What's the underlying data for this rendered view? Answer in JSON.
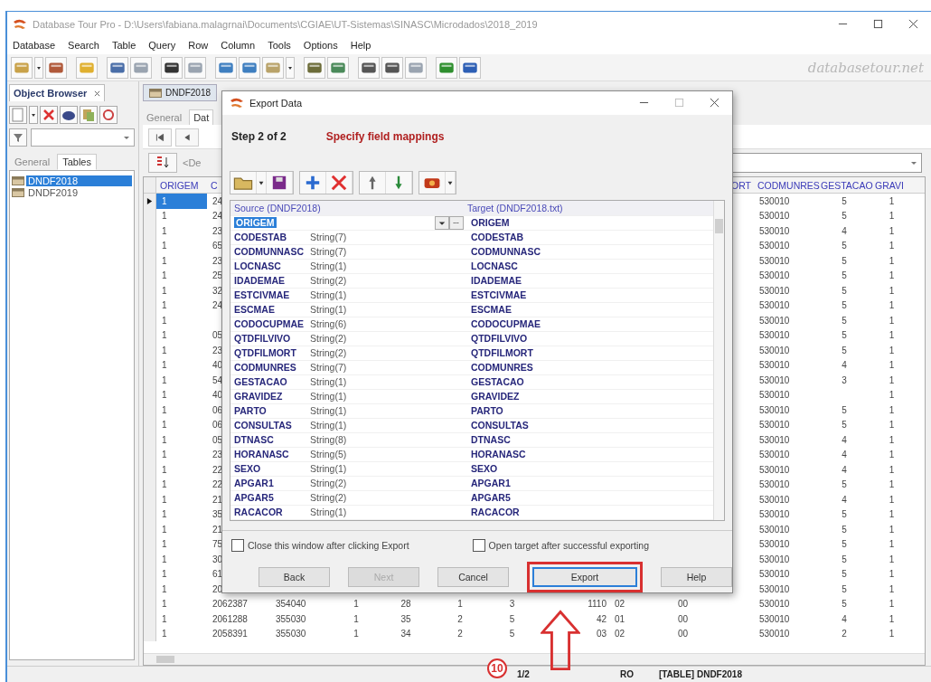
{
  "window": {
    "title": "Database Tour Pro - D:\\Users\\fabiana.malagrnai\\Documents\\CGIAE\\UT-Sistemas\\SINASC\\Microdados\\2018_2019"
  },
  "menu": [
    "Database",
    "Search",
    "Table",
    "Query",
    "Row",
    "Column",
    "Tools",
    "Options",
    "Help"
  ],
  "logo": "databasetour.net",
  "object_browser": {
    "title": "Object Browser",
    "tabs": [
      {
        "label": "General",
        "selected": false
      },
      {
        "label": "Tables",
        "selected": true
      }
    ],
    "tables": [
      {
        "name": "DNDF2018",
        "selected": true
      },
      {
        "name": "DNDF2019",
        "selected": false
      }
    ]
  },
  "document": {
    "tab": "DNDF2018",
    "subtabs": [
      {
        "label": "General",
        "selected": false
      },
      {
        "label": "Dat",
        "selected": true
      }
    ],
    "filter_label": "<De"
  },
  "grid": {
    "header_left": [
      "ORIGEM",
      "C"
    ],
    "header_right": [
      "ORT",
      "CODMUNRES",
      "GESTACAO",
      "GRAVI"
    ],
    "partial_rows": [
      {
        "selected": true,
        "origem": "1",
        "codestab": "24",
        "codmunres": "530010",
        "gestacao": "5",
        "gravidez": "1"
      },
      {
        "selected": false,
        "origem": "1",
        "codestab": "24",
        "codmunres": "530010",
        "gestacao": "5",
        "gravidez": "1"
      },
      {
        "selected": false,
        "origem": "1",
        "codestab": "23",
        "codmunres": "530010",
        "gestacao": "4",
        "gravidez": "1"
      },
      {
        "selected": false,
        "origem": "1",
        "codestab": "65",
        "codmunres": "530010",
        "gestacao": "5",
        "gravidez": "1"
      },
      {
        "selected": false,
        "origem": "1",
        "codestab": "23",
        "codmunres": "530010",
        "gestacao": "5",
        "gravidez": "1"
      },
      {
        "selected": false,
        "origem": "1",
        "codestab": "25",
        "codmunres": "530010",
        "gestacao": "5",
        "gravidez": "1"
      },
      {
        "selected": false,
        "origem": "1",
        "codestab": "32",
        "codmunres": "530010",
        "gestacao": "5",
        "gravidez": "1"
      },
      {
        "selected": false,
        "origem": "1",
        "codestab": "24",
        "codmunres": "530010",
        "gestacao": "5",
        "gravidez": "1"
      },
      {
        "selected": false,
        "origem": "1",
        "codmunres": "530010",
        "gestacao": "5",
        "gravidez": "1"
      },
      {
        "selected": false,
        "origem": "1",
        "codestab": "05",
        "codmunres": "530010",
        "gestacao": "5",
        "gravidez": "1"
      },
      {
        "selected": false,
        "origem": "1",
        "codestab": "23",
        "codmunres": "530010",
        "gestacao": "5",
        "gravidez": "1"
      },
      {
        "selected": false,
        "origem": "1",
        "codestab": "40",
        "codmunres": "530010",
        "gestacao": "4",
        "gravidez": "1"
      },
      {
        "selected": false,
        "origem": "1",
        "codestab": "54",
        "codmunres": "530010",
        "gestacao": "3",
        "gravidez": "1"
      },
      {
        "selected": false,
        "origem": "1",
        "codestab": "40",
        "codmunres": "530010",
        "gravidez": "1"
      },
      {
        "selected": false,
        "origem": "1",
        "codestab": "06",
        "codmunres": "530010",
        "gestacao": "5",
        "gravidez": "1"
      },
      {
        "selected": false,
        "origem": "1",
        "codestab": "06",
        "codmunres": "530010",
        "gestacao": "5",
        "gravidez": "1"
      },
      {
        "selected": false,
        "origem": "1",
        "codestab": "05",
        "codmunres": "530010",
        "gestacao": "4",
        "gravidez": "1"
      },
      {
        "selected": false,
        "origem": "1",
        "codestab": "23",
        "codmunres": "530010",
        "gestacao": "4",
        "gravidez": "1"
      },
      {
        "selected": false,
        "origem": "1",
        "codestab": "22",
        "codmunres": "530010",
        "gestacao": "4",
        "gravidez": "1"
      },
      {
        "selected": false,
        "origem": "1",
        "codestab": "22",
        "codmunres": "530010",
        "gestacao": "5",
        "gravidez": "1"
      },
      {
        "selected": false,
        "origem": "1",
        "codestab": "21",
        "codmunres": "530010",
        "gestacao": "4",
        "gravidez": "1"
      },
      {
        "selected": false,
        "origem": "1",
        "codestab": "35",
        "codmunres": "530010",
        "gestacao": "5",
        "gravidez": "1"
      },
      {
        "selected": false,
        "origem": "1",
        "codestab": "21",
        "codmunres": "530010",
        "gestacao": "5",
        "gravidez": "1"
      },
      {
        "selected": false,
        "origem": "1",
        "codestab": "75",
        "codmunres": "530010",
        "gestacao": "5",
        "gravidez": "1"
      },
      {
        "selected": false,
        "origem": "1",
        "codestab": "30",
        "codmunres": "530010",
        "gestacao": "5",
        "gravidez": "1"
      },
      {
        "selected": false,
        "origem": "1",
        "codestab": "61",
        "codmunres": "530010",
        "gestacao": "5",
        "gravidez": "1"
      },
      {
        "selected": false,
        "origem": "1",
        "codestab": "20",
        "codmunres": "530010",
        "gestacao": "5",
        "gravidez": "1"
      }
    ],
    "rows": [
      {
        "selected": false,
        "cells": [
          "1",
          "2062387",
          "354040",
          "1",
          "28",
          "1",
          "3",
          "1110",
          "02",
          "00",
          "530010",
          "5",
          "1"
        ]
      },
      {
        "selected": false,
        "cells": [
          "1",
          "2061288",
          "355030",
          "1",
          "35",
          "2",
          "5",
          "42",
          "01",
          "00",
          "530010",
          "4",
          "1"
        ]
      },
      {
        "selected": false,
        "cells": [
          "1",
          "2058391",
          "355030",
          "1",
          "34",
          "2",
          "5",
          "03",
          "02",
          "00",
          "530010",
          "2",
          "1"
        ]
      }
    ]
  },
  "dialog": {
    "title": "Export Data",
    "step": "Step 2 of 2",
    "heading": "Specify field mappings",
    "source_header": "Source (DNDF2018)",
    "target_header": "Target (DNDF2018.txt)",
    "mappings": [
      {
        "source": "ORIGEM",
        "target": "ORIGEM",
        "selected": true
      },
      {
        "source": "CODESTAB",
        "type": "String(7)",
        "target": "CODESTAB",
        "selected": false
      },
      {
        "source": "CODMUNNASC",
        "type": "String(7)",
        "target": "CODMUNNASC",
        "selected": false
      },
      {
        "source": "LOCNASC",
        "type": "String(1)",
        "target": "LOCNASC",
        "selected": false
      },
      {
        "source": "IDADEMAE",
        "type": "String(2)",
        "target": "IDADEMAE",
        "selected": false
      },
      {
        "source": "ESTCIVMAE",
        "type": "String(1)",
        "target": "ESTCIVMAE",
        "selected": false
      },
      {
        "source": "ESCMAE",
        "type": "String(1)",
        "target": "ESCMAE",
        "selected": false
      },
      {
        "source": "CODOCUPMAE",
        "type": "String(6)",
        "target": "CODOCUPMAE",
        "selected": false
      },
      {
        "source": "QTDFILVIVO",
        "type": "String(2)",
        "target": "QTDFILVIVO",
        "selected": false
      },
      {
        "source": "QTDFILMORT",
        "type": "String(2)",
        "target": "QTDFILMORT",
        "selected": false
      },
      {
        "source": "CODMUNRES",
        "type": "String(7)",
        "target": "CODMUNRES",
        "selected": false
      },
      {
        "source": "GESTACAO",
        "type": "String(1)",
        "target": "GESTACAO",
        "selected": false
      },
      {
        "source": "GRAVIDEZ",
        "type": "String(1)",
        "target": "GRAVIDEZ",
        "selected": false
      },
      {
        "source": "PARTO",
        "type": "String(1)",
        "target": "PARTO",
        "selected": false
      },
      {
        "source": "CONSULTAS",
        "type": "String(1)",
        "target": "CONSULTAS",
        "selected": false
      },
      {
        "source": "DTNASC",
        "type": "String(8)",
        "target": "DTNASC",
        "selected": false
      },
      {
        "source": "HORANASC",
        "type": "String(5)",
        "target": "HORANASC",
        "selected": false
      },
      {
        "source": "SEXO",
        "type": "String(1)",
        "target": "SEXO",
        "selected": false
      },
      {
        "source": "APGAR1",
        "type": "String(2)",
        "target": "APGAR1",
        "selected": false
      },
      {
        "source": "APGAR5",
        "type": "String(2)",
        "target": "APGAR5",
        "selected": false
      },
      {
        "source": "RACACOR",
        "type": "String(1)",
        "target": "RACACOR",
        "selected": false
      }
    ],
    "options": [
      {
        "label": "Close this window after clicking Export",
        "checked": false
      },
      {
        "label": "Open target after successful exporting",
        "checked": false
      }
    ],
    "buttons": [
      {
        "label": "Back",
        "disabled": false,
        "highlighted": false
      },
      {
        "label": "Next",
        "disabled": true,
        "highlighted": false
      },
      {
        "label": "Cancel",
        "disabled": false,
        "highlighted": false
      },
      {
        "label": "Export",
        "disabled": false,
        "highlighted": true
      },
      {
        "label": "Help",
        "disabled": false,
        "highlighted": false
      }
    ]
  },
  "status_bar": [
    "1/2",
    "RO",
    "[TABLE] DNDF2018"
  ],
  "annotation": {
    "number": "10"
  }
}
